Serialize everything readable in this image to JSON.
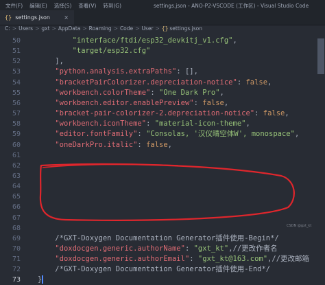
{
  "titlebar": {
    "menu": [
      "文件(F)",
      "编辑(E)",
      "选择(S)",
      "查看(V)",
      "转到(G)"
    ],
    "title": "settings.json - ANO-P2-VSCODE (工作区) - Visual Studio Code"
  },
  "tab": {
    "label": "settings.json",
    "close": "×",
    "icon": "json-file-icon"
  },
  "breadcrumbs": {
    "parts": [
      "C:",
      "Users",
      "gxt",
      "AppData",
      "Roaming",
      "Code",
      "User"
    ],
    "file": "settings.json",
    "sep": ">"
  },
  "editor": {
    "lines": [
      {
        "num": "50",
        "segs": [
          {
            "t": "        ",
            "c": "p"
          },
          {
            "t": "\"interface/ftdi/esp32_devkitj_v1.cfg\"",
            "c": "s"
          },
          {
            "t": ",",
            "c": "p"
          }
        ]
      },
      {
        "num": "51",
        "segs": [
          {
            "t": "        ",
            "c": "p"
          },
          {
            "t": "\"target/esp32.cfg\"",
            "c": "s"
          }
        ]
      },
      {
        "num": "52",
        "segs": [
          {
            "t": "    ],",
            "c": "p"
          }
        ]
      },
      {
        "num": "53",
        "segs": [
          {
            "t": "    ",
            "c": "p"
          },
          {
            "t": "\"python.analysis.extraPaths\"",
            "c": "k"
          },
          {
            "t": ": [],",
            "c": "p"
          }
        ]
      },
      {
        "num": "54",
        "segs": [
          {
            "t": "    ",
            "c": "p"
          },
          {
            "t": "\"bracketPairColorizer.depreciation-notice\"",
            "c": "k"
          },
          {
            "t": ": ",
            "c": "p"
          },
          {
            "t": "false",
            "c": "n"
          },
          {
            "t": ",",
            "c": "p"
          }
        ]
      },
      {
        "num": "55",
        "segs": [
          {
            "t": "    ",
            "c": "p"
          },
          {
            "t": "\"workbench.colorTheme\"",
            "c": "k"
          },
          {
            "t": ": ",
            "c": "p"
          },
          {
            "t": "\"One Dark Pro\"",
            "c": "s"
          },
          {
            "t": ",",
            "c": "p"
          }
        ]
      },
      {
        "num": "56",
        "segs": [
          {
            "t": "    ",
            "c": "p"
          },
          {
            "t": "\"workbench.editor.enablePreview\"",
            "c": "k"
          },
          {
            "t": ": ",
            "c": "p"
          },
          {
            "t": "false",
            "c": "n"
          },
          {
            "t": ",",
            "c": "p"
          }
        ]
      },
      {
        "num": "57",
        "segs": [
          {
            "t": "    ",
            "c": "p"
          },
          {
            "t": "\"bracket-pair-colorizer-2.depreciation-notice\"",
            "c": "k"
          },
          {
            "t": ": ",
            "c": "p"
          },
          {
            "t": "false",
            "c": "n"
          },
          {
            "t": ",",
            "c": "p"
          }
        ]
      },
      {
        "num": "58",
        "segs": [
          {
            "t": "    ",
            "c": "p"
          },
          {
            "t": "\"workbench.iconTheme\"",
            "c": "k"
          },
          {
            "t": ": ",
            "c": "p"
          },
          {
            "t": "\"material-icon-theme\"",
            "c": "s"
          },
          {
            "t": ",",
            "c": "p"
          }
        ]
      },
      {
        "num": "59",
        "segs": [
          {
            "t": "    ",
            "c": "p"
          },
          {
            "t": "\"editor.fontFamily\"",
            "c": "k"
          },
          {
            "t": ": ",
            "c": "p"
          },
          {
            "t": "\"Consolas, '汉仪晴空体W', monospace\"",
            "c": "s"
          },
          {
            "t": ",",
            "c": "p"
          }
        ]
      },
      {
        "num": "60",
        "segs": [
          {
            "t": "    ",
            "c": "p"
          },
          {
            "t": "\"oneDarkPro.italic\"",
            "c": "k"
          },
          {
            "t": ": ",
            "c": "p"
          },
          {
            "t": "false",
            "c": "n"
          },
          {
            "t": ",",
            "c": "p"
          }
        ]
      },
      {
        "num": "61",
        "segs": []
      },
      {
        "num": "62",
        "segs": []
      },
      {
        "num": "63",
        "segs": []
      },
      {
        "num": "64",
        "segs": []
      },
      {
        "num": "65",
        "segs": []
      },
      {
        "num": "66",
        "segs": []
      },
      {
        "num": "67",
        "segs": []
      },
      {
        "num": "68",
        "segs": []
      },
      {
        "num": "69",
        "segs": [
          {
            "t": "    ",
            "c": "p"
          },
          {
            "t": "/*GXT-Doxygen Documentation Generator插件使用-Begin*/",
            "c": "c"
          }
        ]
      },
      {
        "num": "70",
        "segs": [
          {
            "t": "    ",
            "c": "p"
          },
          {
            "t": "\"doxdocgen.generic.authorName\"",
            "c": "k"
          },
          {
            "t": ": ",
            "c": "p"
          },
          {
            "t": "\"gxt_kt\"",
            "c": "s"
          },
          {
            "t": ",//更改作者名",
            "c": "p"
          }
        ]
      },
      {
        "num": "71",
        "segs": [
          {
            "t": "    ",
            "c": "p"
          },
          {
            "t": "\"doxdocgen.generic.authorEmail\"",
            "c": "k"
          },
          {
            "t": ": ",
            "c": "p"
          },
          {
            "t": "\"gxt_kt@163.com\"",
            "c": "s"
          },
          {
            "t": ",//更改邮箱",
            "c": "p"
          }
        ]
      },
      {
        "num": "72",
        "segs": [
          {
            "t": "    ",
            "c": "p"
          },
          {
            "t": "/*GXT-Doxygen Documentation Generator插件使用-End*/",
            "c": "c"
          }
        ]
      },
      {
        "num": "73",
        "segs": [
          {
            "t": "}",
            "c": "p"
          }
        ],
        "active": true
      }
    ]
  },
  "watermark": "CSDN @gxt_kt",
  "colors": {
    "background": "#282c34",
    "key": "#e06c75",
    "string": "#98c379",
    "number": "#d19a66",
    "annotation": "#e0262c"
  }
}
